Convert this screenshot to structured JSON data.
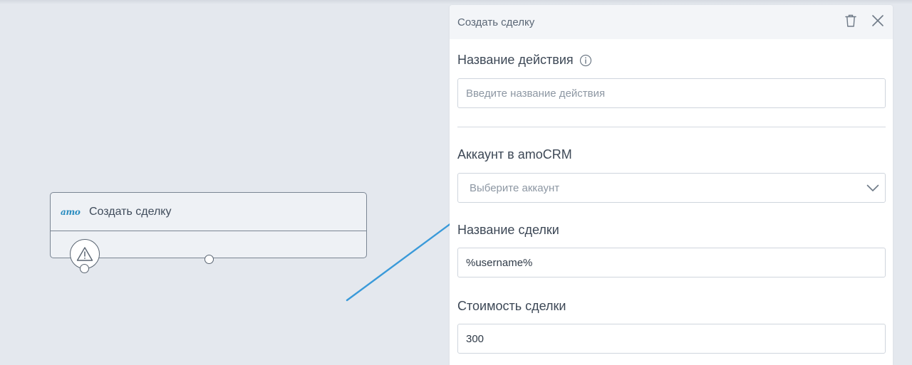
{
  "canvas": {
    "node": {
      "logo_text": "amo",
      "title": "Создать сделку",
      "status_icon": "warning-triangle-icon"
    }
  },
  "panel": {
    "title": "Создать сделку",
    "icons": {
      "delete": "trash-icon",
      "close": "close-icon"
    },
    "action_name": {
      "label": "Название действия",
      "info_icon": "info-icon",
      "placeholder": "Введите название действия",
      "value": ""
    },
    "account": {
      "label": "Аккаунт в amoCRM",
      "placeholder": "Выберите аккаунт",
      "icon": "chevron-down-icon"
    },
    "deal_name": {
      "label": "Название сделки",
      "value": "%username%"
    },
    "deal_price": {
      "label": "Стоимость сделки",
      "value": "300"
    }
  },
  "colors": {
    "canvas_bg": "#e4e8ee",
    "accent_arrow": "#3a9ad9",
    "amo_brand": "#2a8dc0"
  }
}
